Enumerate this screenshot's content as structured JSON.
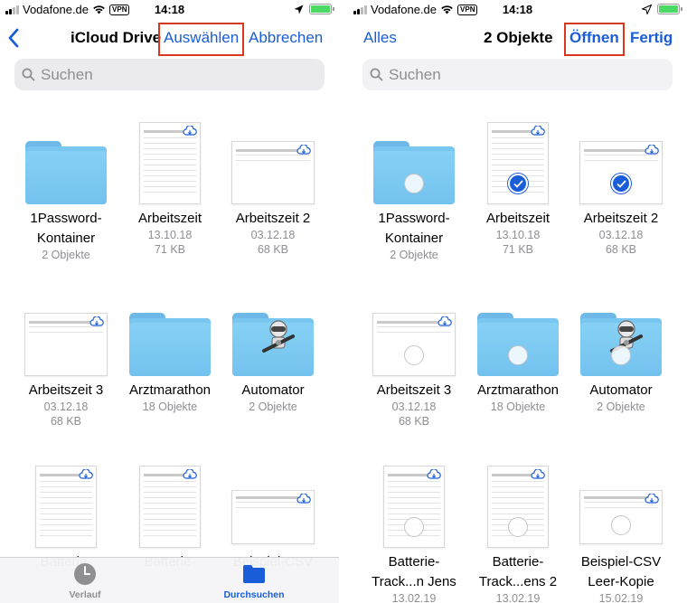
{
  "status": {
    "carrier": "Vodafone.de",
    "vpn": "VPN",
    "time": "14:18"
  },
  "left": {
    "title": "iCloud Drive",
    "select_label": "Auswählen",
    "cancel_label": "Abbrechen",
    "search_placeholder": "Suchen",
    "items": [
      {
        "name": "1Password-",
        "name2": "Kontainer",
        "meta1": "2 Objekte",
        "meta2": ""
      },
      {
        "name": "Arbeitszeit",
        "name2": "",
        "meta1": "13.10.18",
        "meta2": "71 KB"
      },
      {
        "name": "Arbeitszeit 2",
        "name2": "",
        "meta1": "03.12.18",
        "meta2": "68 KB"
      },
      {
        "name": "Arbeitszeit 3",
        "name2": "",
        "meta1": "03.12.18",
        "meta2": "68 KB"
      },
      {
        "name": "Arztmarathon",
        "name2": "",
        "meta1": "18 Objekte",
        "meta2": ""
      },
      {
        "name": "Automator",
        "name2": "",
        "meta1": "2 Objekte",
        "meta2": ""
      },
      {
        "name": "Batterie-",
        "name2": "",
        "meta1": "",
        "meta2": ""
      },
      {
        "name": "Batterie-",
        "name2": "",
        "meta1": "",
        "meta2": ""
      },
      {
        "name": "Beispiel-CSV",
        "name2": "",
        "meta1": "",
        "meta2": ""
      }
    ],
    "tabs": [
      {
        "label": "Verlauf",
        "active": false
      },
      {
        "label": "Durchsuchen",
        "active": true
      }
    ]
  },
  "right": {
    "all_label": "Alles",
    "title": "2 Objekte",
    "open_label": "Öffnen",
    "done_label": "Fertig",
    "search_placeholder": "Suchen",
    "items": [
      {
        "name": "1Password-",
        "name2": "Kontainer",
        "meta1": "2 Objekte",
        "meta2": "",
        "selected": false
      },
      {
        "name": "Arbeitszeit",
        "name2": "",
        "meta1": "13.10.18",
        "meta2": "71 KB",
        "selected": true
      },
      {
        "name": "Arbeitszeit 2",
        "name2": "",
        "meta1": "03.12.18",
        "meta2": "68 KB",
        "selected": true
      },
      {
        "name": "Arbeitszeit 3",
        "name2": "",
        "meta1": "03.12.18",
        "meta2": "68 KB",
        "selected": false
      },
      {
        "name": "Arztmarathon",
        "name2": "",
        "meta1": "18 Objekte",
        "meta2": "",
        "selected": false
      },
      {
        "name": "Automator",
        "name2": "",
        "meta1": "2 Objekte",
        "meta2": "",
        "selected": false
      },
      {
        "name": "Batterie-",
        "name2": "Track...n Jens",
        "meta1": "13.02.19",
        "meta2": "",
        "selected": false
      },
      {
        "name": "Batterie-",
        "name2": "Track...ens 2",
        "meta1": "13.02.19",
        "meta2": "",
        "selected": false
      },
      {
        "name": "Beispiel-CSV",
        "name2": "Leer-Kopie",
        "meta1": "15.02.19",
        "meta2": "",
        "selected": false
      }
    ]
  },
  "colors": {
    "accent": "#1a5dd8",
    "highlight": "#d9381e",
    "folder": "#79c7f0",
    "battery": "#4cd964"
  }
}
